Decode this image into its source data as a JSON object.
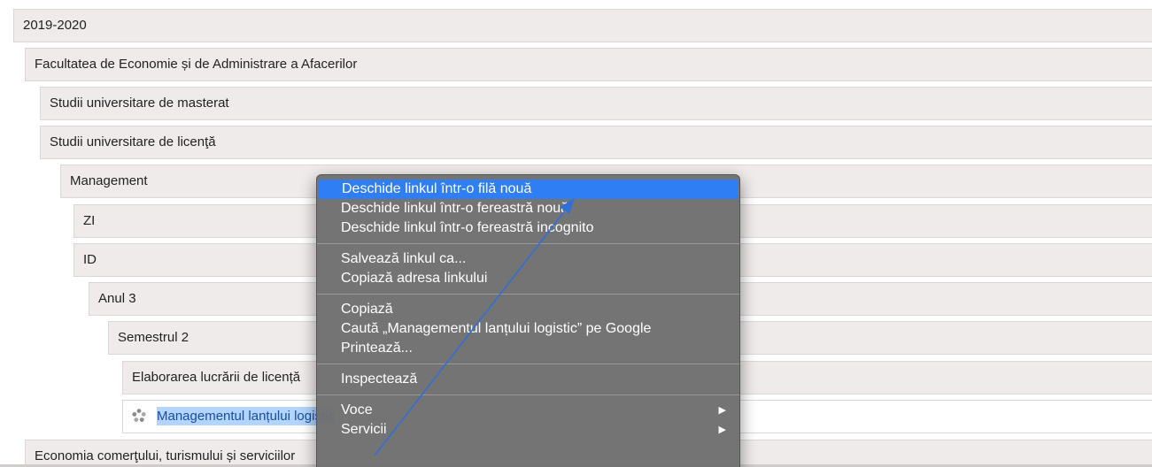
{
  "tree": {
    "rows": [
      {
        "label": "2019-2020"
      },
      {
        "label": "Facultatea de Economie și de Administrare a Afacerilor"
      },
      {
        "label": "Studii universitare de masterat"
      },
      {
        "label": "Studii universitare de licenţă"
      },
      {
        "label": "Management"
      },
      {
        "label": "ZI"
      },
      {
        "label": "ID"
      },
      {
        "label": "Anul 3"
      },
      {
        "label": "Semestrul 2"
      },
      {
        "label": "Elaborarea lucrării de licență"
      },
      {
        "label": "Managementul lanțului logistic",
        "icon": "course-icon"
      },
      {
        "label": "Economia comerţului, turismului și serviciilor"
      }
    ]
  },
  "context_menu": {
    "items": [
      {
        "label": "Deschide linkul într-o filă nouă"
      },
      {
        "label": "Deschide linkul într-o fereastră nouă"
      },
      {
        "label": "Deschide linkul într-o fereastră incognito"
      },
      {
        "label": "Salvează linkul ca..."
      },
      {
        "label": "Copiază adresa linkului"
      },
      {
        "label": "Copiază"
      },
      {
        "label": "Caută „Managementul lanțului logistic” pe Google"
      },
      {
        "label": "Printează..."
      },
      {
        "label": "Inspectează"
      },
      {
        "label": "Voce",
        "submenu_indicator": "▶"
      },
      {
        "label": "Servicii",
        "submenu_indicator": "▶"
      }
    ]
  },
  "colors": {
    "row_background": "#efebeb",
    "menu_background": "#707070",
    "menu_highlight": "#2f7ef4",
    "selection": "#b3d4fd",
    "arrow": "#2f6fd6"
  },
  "annotation": {
    "icon": "arrow-annotation-icon"
  }
}
